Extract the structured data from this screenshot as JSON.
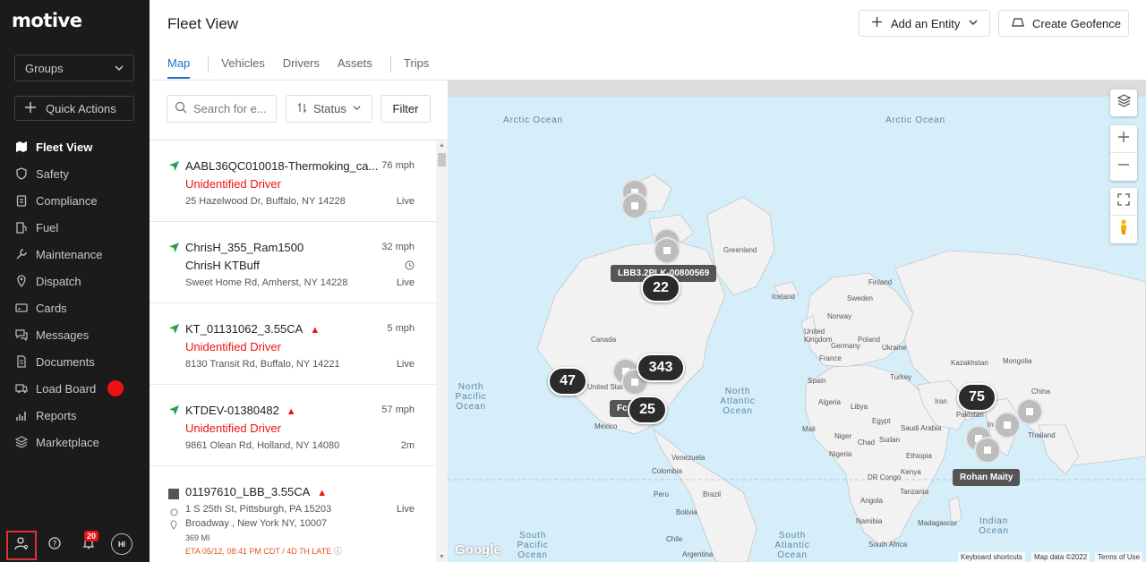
{
  "brand": "motive",
  "sidebar": {
    "groups_label": "Groups",
    "quick_actions_label": "Quick Actions",
    "items": [
      {
        "label": "Fleet View",
        "icon": "map-icon"
      },
      {
        "label": "Safety",
        "icon": "shield-icon"
      },
      {
        "label": "Compliance",
        "icon": "clipboard-icon"
      },
      {
        "label": "Fuel",
        "icon": "fuel-icon"
      },
      {
        "label": "Maintenance",
        "icon": "wrench-icon"
      },
      {
        "label": "Dispatch",
        "icon": "location-pin-icon"
      },
      {
        "label": "Cards",
        "icon": "card-icon"
      },
      {
        "label": "Messages",
        "icon": "messages-icon"
      },
      {
        "label": "Documents",
        "icon": "document-icon"
      },
      {
        "label": "Load Board",
        "icon": "truck-icon"
      },
      {
        "label": "Reports",
        "icon": "reports-icon"
      },
      {
        "label": "Marketplace",
        "icon": "layers-icon"
      }
    ],
    "notification_count": "20",
    "avatar_initials": "HI"
  },
  "header": {
    "title": "Fleet View",
    "add_entity_label": "Add an Entity",
    "create_geofence_label": "Create Geofence",
    "tabs": [
      "Map",
      "Vehicles",
      "Drivers",
      "Assets",
      "Trips"
    ]
  },
  "list": {
    "search_placeholder": "Search for e...",
    "status_label": "Status",
    "filter_label": "Filter",
    "rows": [
      {
        "name": "AABL36QC010018-Thermoking_ca...",
        "speed": "76 mph",
        "driver": "Unidentified Driver",
        "address": "25 Hazelwood Dr, Buffalo, NY 14228",
        "status": "Live"
      },
      {
        "name": "ChrisH_355_Ram1500",
        "speed": "32 mph",
        "driver": "ChrisH KTBuff",
        "address": "Sweet Home Rd, Amherst, NY 14228",
        "status": "Live"
      },
      {
        "name": "KT_01131062_3.55CA",
        "speed": "5 mph",
        "driver": "Unidentified Driver",
        "address": "8130 Transit Rd, Buffalo, NY 14221",
        "status": "Live"
      },
      {
        "name": "KTDEV-01380482",
        "speed": "57 mph",
        "driver": "Unidentified Driver",
        "address": "9861 Olean Rd, Holland, NY 14080",
        "status": "2m"
      }
    ],
    "row5": {
      "name": "01197610_LBB_3.55CA",
      "origin": "1 S 25th St, Pittsburgh, PA 15203",
      "status": "Live",
      "destination": "Broadway , New York NY, 10007",
      "miles": "369 MI",
      "eta": "ETA 05/12, 08:41 PM CDT",
      "late": "4D 7H LATE"
    }
  },
  "map": {
    "oceans": {
      "arctic_left": "Arctic Ocean",
      "arctic_right": "Arctic Ocean",
      "north_pacific": "North Pacific Ocean",
      "north_atlantic": "North Atlantic Ocean",
      "indian": "Indian Ocean",
      "south_pacific": "South Pacific Ocean",
      "south_atlantic": "South Atlantic Ocean"
    },
    "countries": {
      "greenland": "Greenland",
      "iceland": "Iceland",
      "sweden": "Sweden",
      "finland": "Finland",
      "norway": "Norway",
      "uk": "United Kingdom",
      "poland": "Poland",
      "germany": "Germany",
      "ukraine": "Ukraine",
      "france": "France",
      "spain": "Spain",
      "turkey": "Turkey",
      "kazakhstan": "Kazakhstan",
      "mongolia": "Mongolia",
      "china": "China",
      "iran": "Iran",
      "pakistan": "Pakistan",
      "india": "India",
      "thailand": "Thailand",
      "saudi": "Saudi Arabia",
      "egypt": "Egypt",
      "algeria": "Algeria",
      "libya": "Libya",
      "mali": "Mali",
      "niger": "Niger",
      "chad": "Chad",
      "sudan": "Sudan",
      "ethiopia": "Ethiopia",
      "nigeria": "Nigeria",
      "drc": "DR Congo",
      "kenya": "Kenya",
      "tanzania": "Tanzania",
      "angola": "Angola",
      "namibia": "Namibia",
      "south_africa": "South Africa",
      "madagascar": "Madagascar",
      "canada": "Canada",
      "united_states": "United States",
      "mexico": "Mexico",
      "venezuela": "Venezuela",
      "colombia": "Colombia",
      "peru": "Peru",
      "brazil": "Brazil",
      "bolivia": "Bolivia",
      "chile": "Chile",
      "argentina": "Argentina"
    },
    "clusters": [
      "22",
      "343",
      "47",
      "25",
      "75"
    ],
    "tooltips": {
      "vehicle": "LBB3.2PLK-00800569",
      "partial": "Fc",
      "driver": "Rohan Maity"
    },
    "attribution": {
      "shortcuts": "Keyboard shortcuts",
      "data": "Map data ©2022",
      "terms": "Terms of Use"
    },
    "google": "Google"
  },
  "colors": {
    "sidebar_bg": "#1b1b1b",
    "accent": "#1a73c8",
    "alert": "#e11111",
    "live_arrow": "#2e9e46"
  }
}
